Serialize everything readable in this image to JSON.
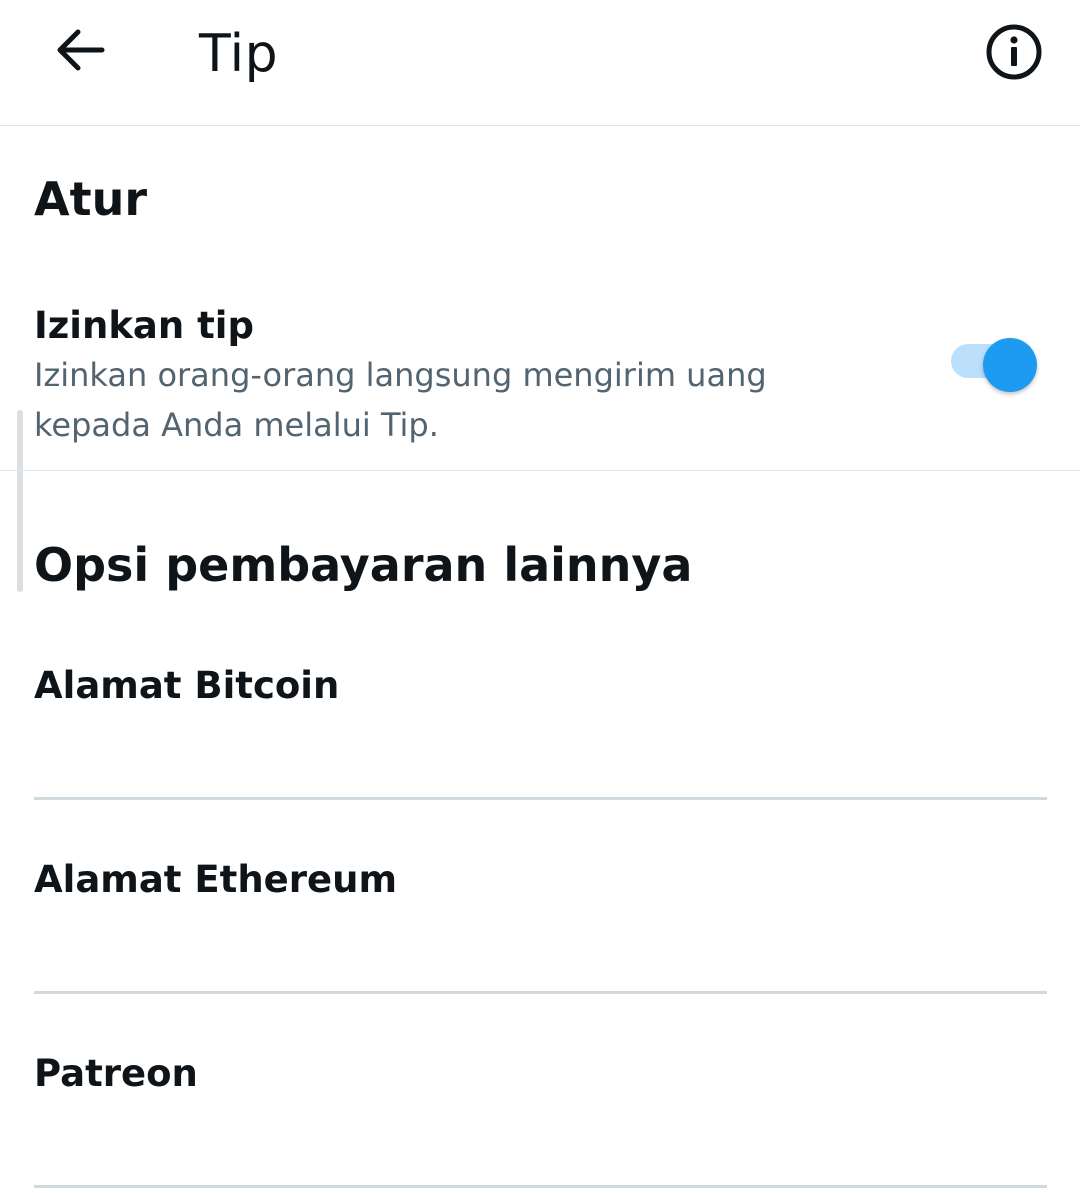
{
  "header": {
    "title": "Tip",
    "back_icon": "arrow-left-icon",
    "info_icon": "info-icon"
  },
  "settings": {
    "section_title": "Atur",
    "allow_tips": {
      "label": "Izinkan tip",
      "description": "Izinkan orang-orang langsung mengirim uang kepada Anda melalui Tip.",
      "enabled": true
    }
  },
  "payment_options": {
    "section_title": "Opsi pembayaran lainnya",
    "fields": [
      {
        "label": "Alamat Bitcoin",
        "value": ""
      },
      {
        "label": "Alamat Ethereum",
        "value": ""
      },
      {
        "label": "Patreon",
        "value": ""
      }
    ]
  },
  "colors": {
    "accent": "#1d9bf0",
    "toggle_track": "#bcdffb",
    "text_primary": "#0f1419",
    "text_secondary": "#536471",
    "divider": "#e1e6ea"
  }
}
